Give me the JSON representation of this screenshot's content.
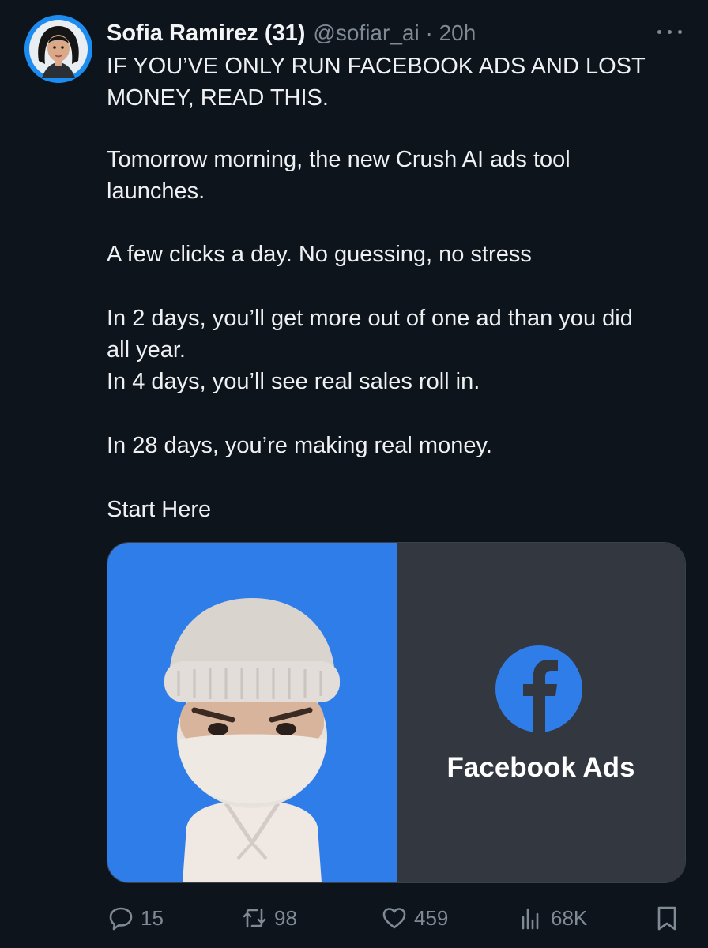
{
  "post": {
    "author_name": "Sofia Ramirez (31)",
    "handle": "@sofiar_ai",
    "separator": "·",
    "time": "20h",
    "lines": [
      "IF YOU’VE ONLY RUN FACEBOOK ADS AND LOST",
      "MONEY, READ THIS.",
      "Tomorrow morning, the new Crush AI ads tool",
      "launches.",
      "A few clicks a day. No guessing, no stress",
      "In 2 days, you’ll get more out of one ad than you did",
      "all year.",
      "In 4 days, you’ll see real sales roll in.",
      "In 28 days, you’re making real money.",
      "Start Here"
    ]
  },
  "media": {
    "brand_title": "Facebook Ads",
    "logo_icon": "facebook-logo-icon",
    "left_bg": "#2f7de8",
    "right_bg": "#33373f"
  },
  "actions": {
    "replies": "15",
    "reposts": "98",
    "likes": "459",
    "views": "68K"
  },
  "colors": {
    "background": "#0e141c",
    "text": "#e7e9ea",
    "muted": "#7f8a94",
    "accent": "#1d8cf0"
  }
}
